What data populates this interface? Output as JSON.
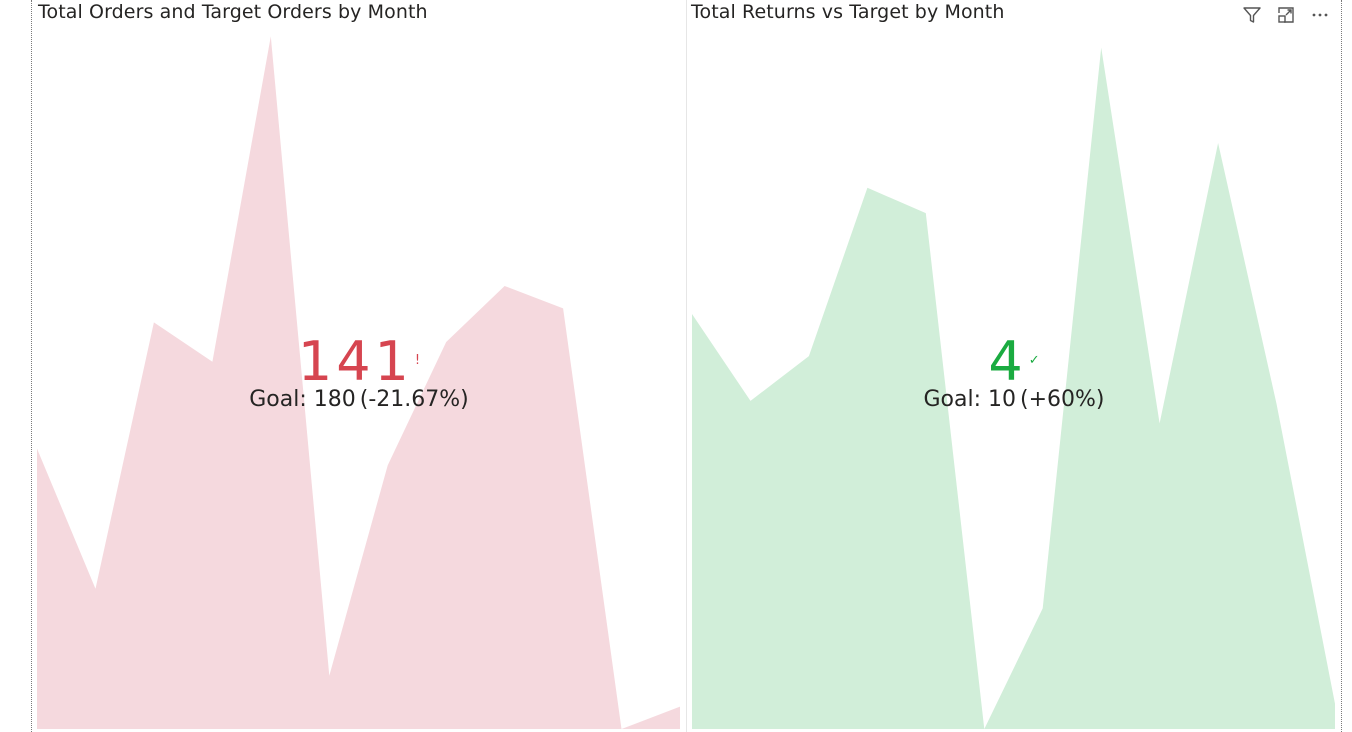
{
  "visuals": [
    {
      "title": "Total Orders and Target Orders by Month",
      "value": "141",
      "indicator": "!",
      "goal_label": "Goal: 180",
      "goal_diff": "(-21.67%)",
      "status_color": "#d64550",
      "fill_color": "#f5d9de"
    },
    {
      "title": "Total Returns vs Target by Month",
      "value": "4",
      "indicator": "✓",
      "goal_label": "Goal: 10",
      "goal_diff": "(+60%)",
      "status_color": "#1aab40",
      "fill_color": "#d1eed9"
    }
  ],
  "toolbar": {
    "icons": [
      "filter-icon",
      "focus-mode-icon",
      "more-options-icon"
    ]
  },
  "chart_data": [
    {
      "type": "area",
      "title": "Total Orders and Target Orders by Month",
      "kpi_value": 141,
      "goal": 180,
      "goal_diff_percent": -21.67,
      "status": "below goal",
      "x": [
        1,
        2,
        3,
        4,
        5,
        6,
        7,
        8,
        9,
        10,
        11,
        12
      ],
      "y": [
        100,
        50,
        145,
        131,
        247,
        19,
        94,
        138,
        158,
        150,
        0,
        8
      ],
      "ylim": [
        0,
        250
      ],
      "grid": false,
      "color": "#f5d9de"
    },
    {
      "type": "area",
      "title": "Total Returns vs Target by Month",
      "kpi_value": 4,
      "goal": 10,
      "goal_diff_percent": 60,
      "status": "on target",
      "x": [
        1,
        2,
        3,
        4,
        5,
        6,
        7,
        8,
        9,
        10,
        11,
        12
      ],
      "y": [
        14.8,
        11.7,
        13.3,
        19.3,
        18.4,
        0,
        4.3,
        24.3,
        10.9,
        20.9,
        11.6,
        0.9
      ],
      "ylim": [
        0,
        25
      ],
      "grid": false,
      "color": "#d1eed9"
    }
  ]
}
